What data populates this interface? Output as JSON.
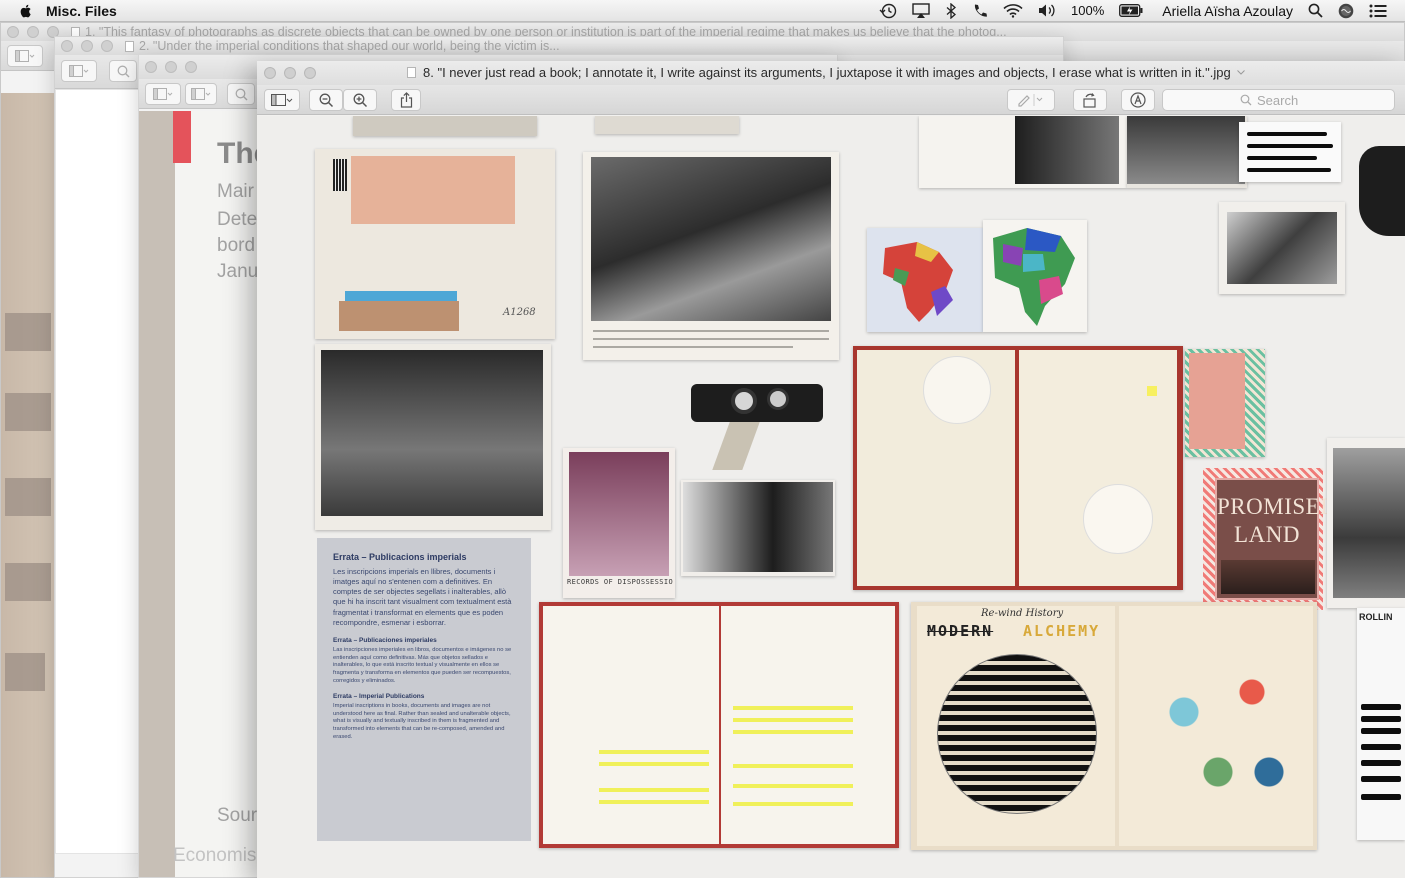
{
  "menubar": {
    "app_name": "Misc. Files",
    "battery": "100%",
    "user": "Ariella Aïsha Azoulay",
    "status_icons": [
      "time-machine-icon",
      "airplay-icon",
      "bluetooth-icon",
      "phone-icon",
      "wifi-icon",
      "volume-icon",
      "battery-icon",
      "spotlight-icon",
      "siri-icon",
      "notification-center-icon"
    ]
  },
  "windows": {
    "back1_title": "1. \"This fantasy of photographs as discrete objects that can be owned by one person or institution is part of the imperial regime that makes us believe that the photog...",
    "back2_title": "2. \"Under the imperial conditions that shaped our world, being the victim is...",
    "front_title": "8. \"I never just read a book; I annotate it, I write against its arguments, I juxtapose it with images and objects, I erase what is written in it.\".jpg"
  },
  "toolbar": {
    "search_placeholder": "Search",
    "back2_search_placeholder": "Search"
  },
  "slide": {
    "title": "The",
    "line1": "Mair",
    "line2": "Dete",
    "line3": "bord",
    "line4": "Janu",
    "footer": "Sour",
    "footer2": "Economis"
  },
  "photo": {
    "errata_title": "Errata – Publicacions imperials",
    "errata_body": "Les inscripcions imperials en llibres, documents i imatges aquí no s'entenen com a definitives. En comptes de ser objectes segellats i inalterables, allò que hi ha inscrit tant visualment com textualment està fragmentat i transformat en elements que es poden recompondre, esmenar i esborrar.",
    "errata_es_title": "Errata – Publicaciones imperiales",
    "errata_es_body": "Las inscripciones imperiales en libros, documentos e imágenes no se entienden aquí como definitivas. Más que objetos sellados e inalterables, lo que está inscrito textual y visualmente en ellos se fragmenta y transforma en elementos que pueden ser recompuestos, corregidos y eliminados.",
    "errata_en_title": "Errata – Imperial Publications",
    "errata_en_body": "Imperial inscriptions in books, documents and images are not understood here as final. Rather than sealed and unalterable objects, what is visually and textually inscribed in them is fragmented and transformed into elements that can be re-composed, amended and erased.",
    "book_title_promised_1": "PROMISED",
    "book_title_promised_2": "LAND",
    "records_label": "RECORDS OF DISPOSSESSIO",
    "alchemy_struck": "MODERN",
    "alchemy_word": "ALCHEMY",
    "rewind_label": "Re-wind History",
    "photo_code": "A1268",
    "card_label_right": "ROLLIN"
  },
  "colors": {
    "menubar_bg": "#ececec",
    "window_bg": "#efeeec",
    "errata_bg": "#c9cbd1",
    "promised_land": "#7a4e49",
    "highlight": "#f0f05a"
  }
}
